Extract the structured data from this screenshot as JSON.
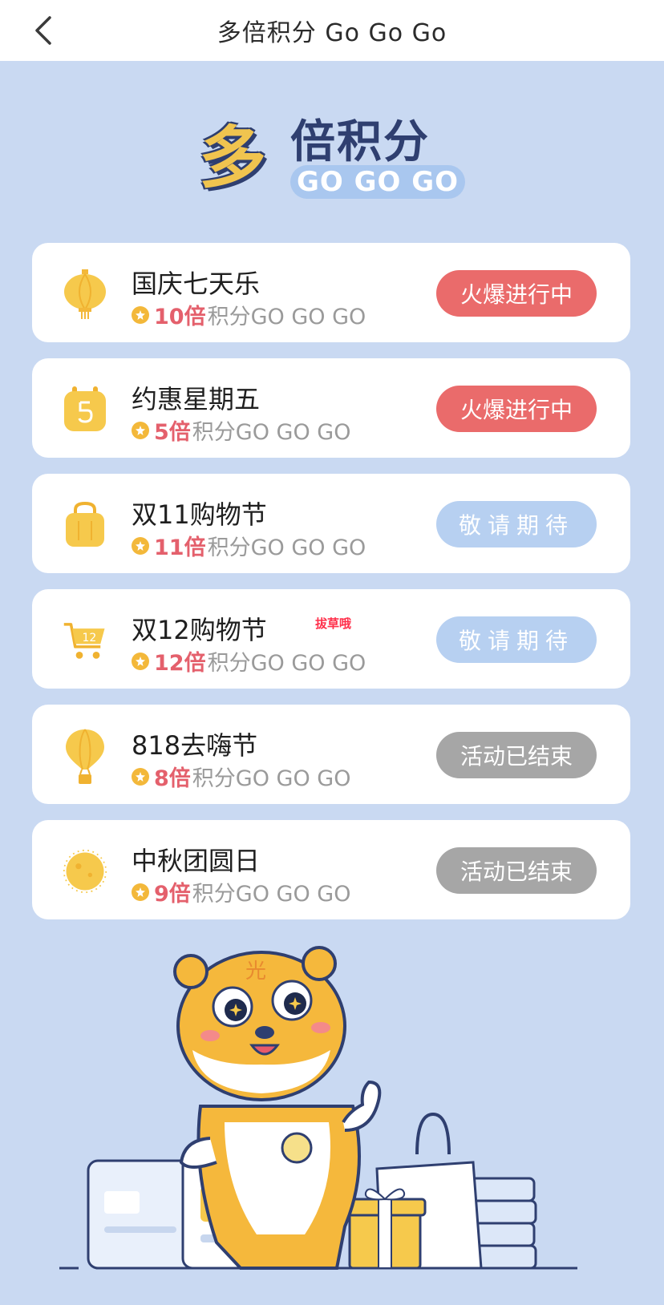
{
  "nav": {
    "back_icon": "chevron-left-icon",
    "title": "多倍积分 Go Go Go"
  },
  "hero": {
    "big_char": "多",
    "title_rest": "倍积分",
    "tagline": "GO GO GO"
  },
  "campaigns": [
    {
      "icon": "lantern-icon",
      "title": "国庆七天乐",
      "multiplier": "10倍",
      "tail": "积分GO GO GO",
      "status": "火爆进行中",
      "state": "hot"
    },
    {
      "icon": "calendar-five-icon",
      "title": "约惠星期五",
      "multiplier": "5倍",
      "tail": "积分GO GO GO",
      "status": "火爆进行中",
      "state": "hot"
    },
    {
      "icon": "shopping-bag-icon",
      "title": "双11购物节",
      "multiplier": "11倍",
      "tail": "积分GO GO GO",
      "status": "敬请期待",
      "state": "soon"
    },
    {
      "icon": "shopping-cart-icon",
      "title": "双12购物节",
      "multiplier": "12倍",
      "tail": "积分GO GO GO",
      "status": "敬请期待",
      "state": "soon"
    },
    {
      "icon": "hot-air-balloon-icon",
      "title": "818去嗨节",
      "multiplier": "8倍",
      "tail": "积分GO GO GO",
      "status": "活动已结束",
      "state": "ended"
    },
    {
      "icon": "moon-icon",
      "title": "中秋团圆日",
      "multiplier": "9倍",
      "tail": "积分GO GO GO",
      "status": "活动已结束",
      "state": "ended"
    }
  ],
  "watermark": "拔草哦",
  "mascot": {
    "forehead_char": "光"
  },
  "colors": {
    "background": "#c9d9f2",
    "hot": "#ea6b6b",
    "soon": "#b7d0f1",
    "ended": "#a6a6a6",
    "accent_yellow": "#f3b83a",
    "multiplier": "#e4606c"
  }
}
